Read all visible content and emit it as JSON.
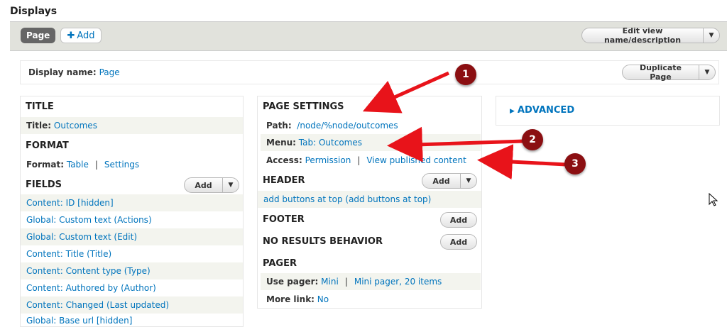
{
  "section_title": "Displays",
  "tabs": {
    "page_label": "Page",
    "add_label": "Add"
  },
  "toolbar": {
    "edit_label": "Edit view name/description"
  },
  "display": {
    "label": "Display name:",
    "value": "Page",
    "duplicate_label": "Duplicate Page"
  },
  "left": {
    "title_heading": "TITLE",
    "title_label": "Title:",
    "title_value": "Outcomes",
    "format_heading": "FORMAT",
    "format_label": "Format:",
    "format_value": "Table",
    "format_settings": "Settings",
    "fields_heading": "FIELDS",
    "fields_add": "Add",
    "fields": [
      "Content: ID [hidden]",
      "Global: Custom text (Actions)",
      "Global: Custom text (Edit)",
      "Content: Title (Title)",
      "Content: Content type (Type)",
      "Content: Authored by (Author)",
      "Content: Changed (Last updated)",
      "Global: Base url [hidden]"
    ]
  },
  "middle": {
    "page_settings_heading": "PAGE SETTINGS",
    "path_label": "Path:",
    "path_value": "/node/%node/outcomes",
    "menu_label": "Menu:",
    "menu_value": "Tab: Outcomes",
    "access_label": "Access:",
    "access_value": "Permission",
    "access_extra": "View published content",
    "header_heading": "HEADER",
    "header_add": "Add",
    "header_item": "add buttons at top (add buttons at top)",
    "footer_heading": "FOOTER",
    "footer_add": "Add",
    "noresults_heading": "NO RESULTS BEHAVIOR",
    "noresults_add": "Add",
    "pager_heading": "PAGER",
    "use_pager_label": "Use pager:",
    "use_pager_value": "Mini",
    "use_pager_extra": "Mini pager, 20 items",
    "more_link_label": "More link:",
    "more_link_value": "No"
  },
  "right": {
    "advanced_label": "ADVANCED"
  },
  "annotations": {
    "m1": "1",
    "m2": "2",
    "m3": "3"
  },
  "colors": {
    "link": "#0074bd",
    "arrow": "#e8131a",
    "marker": "#8b0f12",
    "tab_active": "#666666"
  }
}
